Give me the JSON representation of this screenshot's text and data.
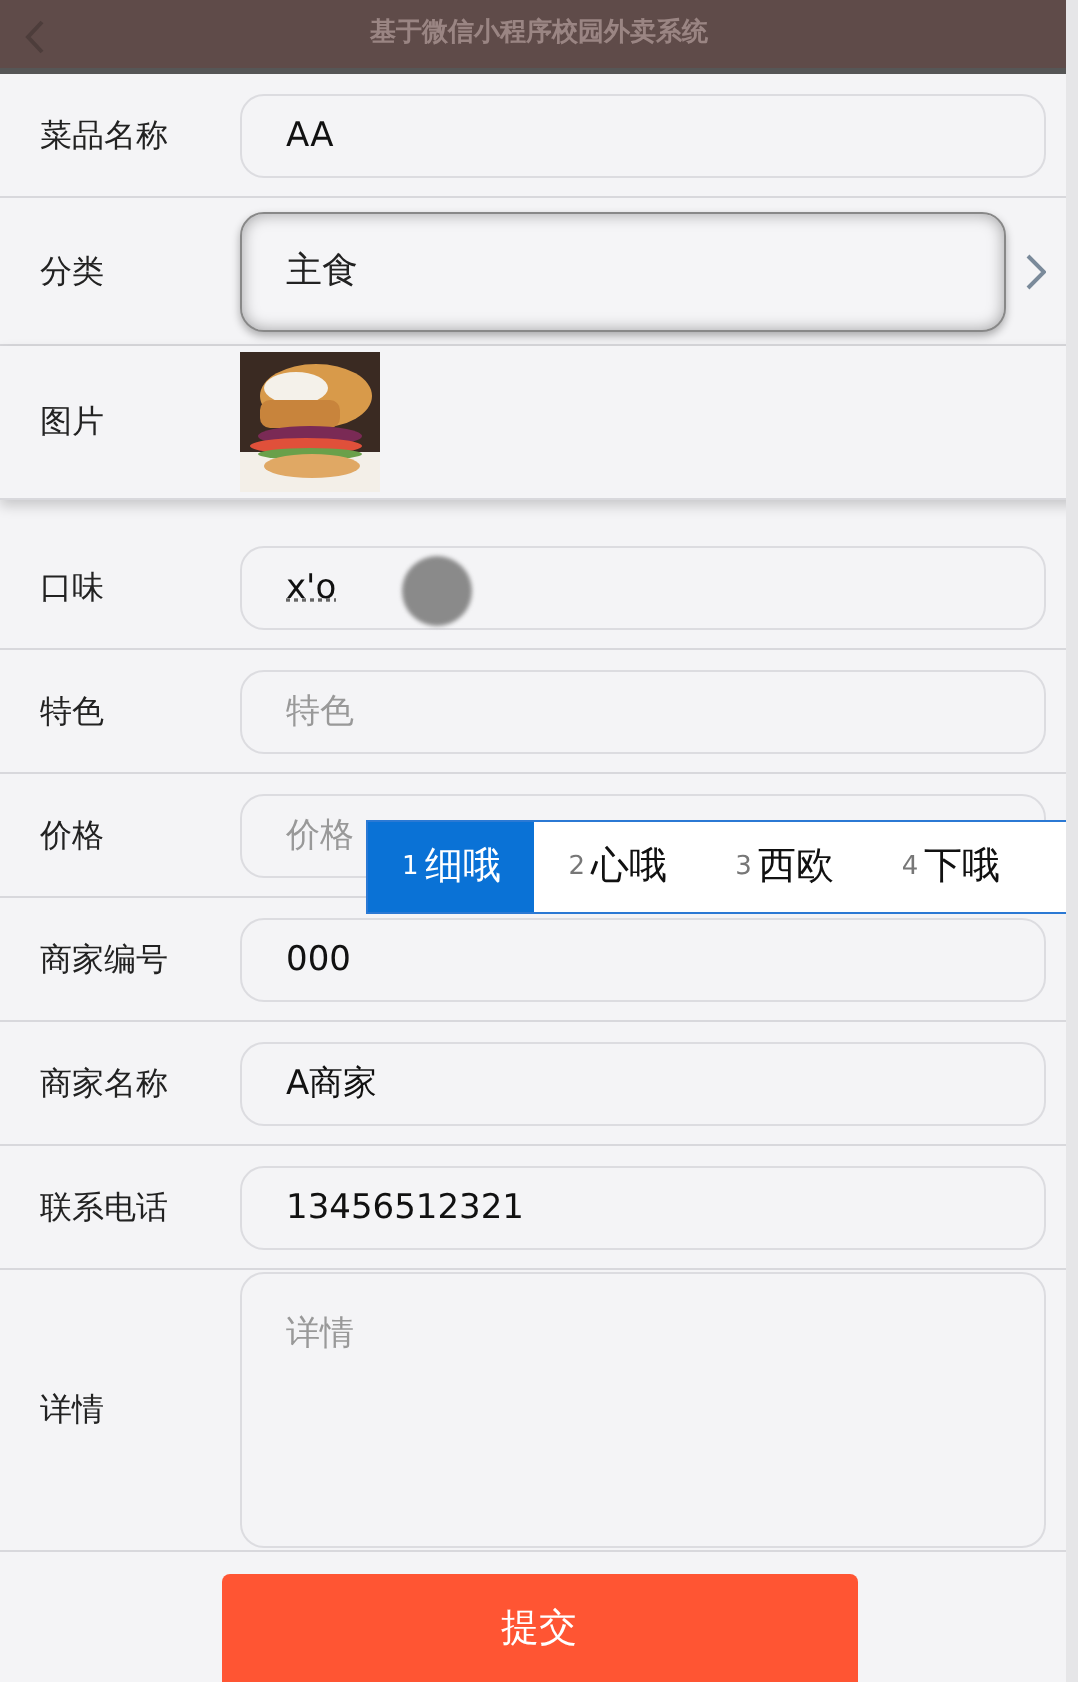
{
  "header": {
    "title": "基于微信小程序校园外卖系统"
  },
  "fields": [
    {
      "label": "菜品名称",
      "kind": "input",
      "value": "AA"
    },
    {
      "label": "分类",
      "kind": "picker",
      "value": "主食"
    },
    {
      "label": "图片"
    },
    {
      "label": "口味",
      "kind": "input",
      "value": "x'o",
      "composing": true
    },
    {
      "label": "特色",
      "kind": "input",
      "placeholder": "特色"
    },
    {
      "label": "价格",
      "kind": "input",
      "placeholder": "价格"
    },
    {
      "label": "商家编号",
      "kind": "input",
      "value": "000"
    },
    {
      "label": "商家名称",
      "kind": "input",
      "value": "A商家"
    },
    {
      "label": "联系电话",
      "kind": "input",
      "value": "13456512321"
    },
    {
      "label": "详情",
      "kind": "textarea",
      "placeholder": "详情"
    }
  ],
  "ime": {
    "candidates": [
      {
        "index": "1",
        "text": "细哦",
        "selected": true
      },
      {
        "index": "2",
        "text": "心哦",
        "selected": false
      },
      {
        "index": "3",
        "text": "西欧",
        "selected": false
      },
      {
        "index": "4",
        "text": "下哦",
        "selected": false
      }
    ]
  },
  "submit": "提交"
}
